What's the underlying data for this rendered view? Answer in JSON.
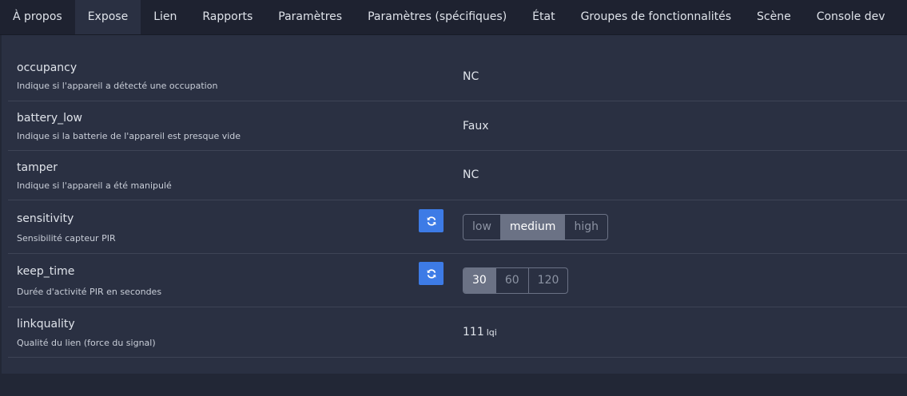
{
  "tabs": [
    "À propos",
    "Expose",
    "Lien",
    "Rapports",
    "Paramètres",
    "Paramètres (spécifiques)",
    "État",
    "Groupes de fonctionnalités",
    "Scène",
    "Console dev"
  ],
  "active_tab": "Expose",
  "rows": {
    "occupancy": {
      "name": "occupancy",
      "desc": "Indique si l'appareil a détecté une occupation",
      "value": "NC"
    },
    "battery_low": {
      "name": "battery_low",
      "desc": "Indique si la batterie de l'appareil est presque vide",
      "value": "Faux"
    },
    "tamper": {
      "name": "tamper",
      "desc": "Indique si l'appareil a été manipulé",
      "value": "NC"
    },
    "sensitivity": {
      "name": "sensitivity",
      "desc": "Sensibilité capteur PIR",
      "options": [
        "low",
        "medium",
        "high"
      ],
      "selected": "medium",
      "refresh_icon": "refresh-icon"
    },
    "keep_time": {
      "name": "keep_time",
      "desc": "Durée d'activité PIR en secondes",
      "options": [
        "30",
        "60",
        "120"
      ],
      "selected": "30",
      "refresh_icon": "refresh-icon"
    },
    "linkquality": {
      "name": "linkquality",
      "desc": "Qualité du lien (force du signal)",
      "value": "111",
      "unit": "lqi"
    }
  },
  "colors": {
    "background": "#222736",
    "card": "#2a3042",
    "accent": "#3d7be6",
    "selected_option": "#6b7285"
  }
}
